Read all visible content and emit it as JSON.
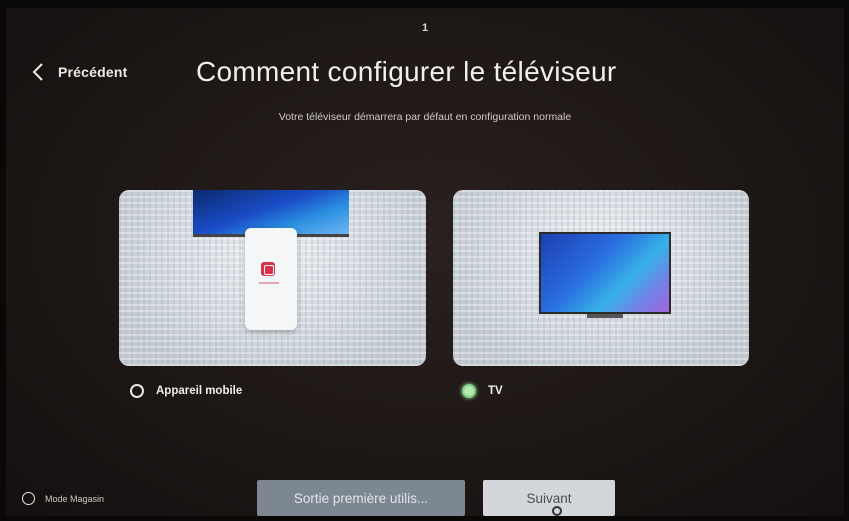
{
  "step_indicator": "1",
  "header": {
    "back_label": "Précédent",
    "title": "Comment configurer le téléviseur",
    "subtitle": "Votre téléviseur démarrera par défaut en configuration normale"
  },
  "options": [
    {
      "label": "Appareil mobile",
      "selected": false,
      "icon": "phone-app-icon"
    },
    {
      "label": "TV",
      "selected": true,
      "icon": "tv-icon"
    }
  ],
  "footer": {
    "store_mode_label": "Mode Magasin",
    "exit_button_label": "Sortie première utilis...",
    "next_button_label": "Suivant"
  },
  "colors": {
    "selected_radio": "#b7e8b0",
    "exit_button_bg": "#7d8792",
    "next_button_bg": "#d3d6da",
    "app_icon": "#d9304b"
  }
}
